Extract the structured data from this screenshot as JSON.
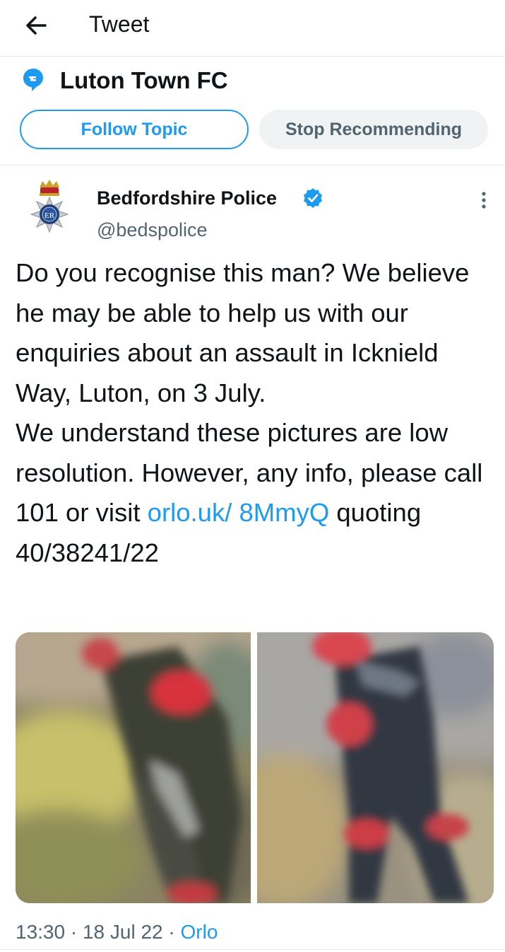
{
  "header": {
    "title": "Tweet",
    "back_icon": "arrow-left-icon"
  },
  "topic": {
    "icon": "topic-bubble-icon",
    "name": "Luton Town FC",
    "follow_label": "Follow Topic",
    "stop_label": "Stop Recommending"
  },
  "tweet": {
    "author": {
      "name": "Bedfordshire Police",
      "handle": "@bedspolice",
      "verified": true,
      "verified_icon": "verified-badge-icon",
      "avatar_icon": "police-crest-icon",
      "avatar_text": "ER"
    },
    "more_icon": "more-vertical-icon",
    "text": {
      "part1": "Do you recognise this man? We believe he may be able to help us with our enquiries about an assault in Icknield Way, Luton, on 3 July.",
      "part2_prefix": "We understand these pictures are low resolution. However, any info, please call 101 or visit ",
      "link": "orlo.uk/ 8MmyQ",
      "part2_suffix": " quoting 40/38241/22"
    },
    "media": [
      {
        "kind": "photo",
        "name": "cctv-photo-1"
      },
      {
        "kind": "photo",
        "name": "cctv-photo-2"
      }
    ],
    "meta": {
      "time": "13:30",
      "sep1": " · ",
      "date": "18 Jul 22",
      "sep2": " · ",
      "source": "Orlo"
    }
  },
  "colors": {
    "accent": "#1d9bf0",
    "text": "#0f1419",
    "secondary": "#536471",
    "divider": "#e6e9ea",
    "button_bg": "#eff3f4"
  }
}
